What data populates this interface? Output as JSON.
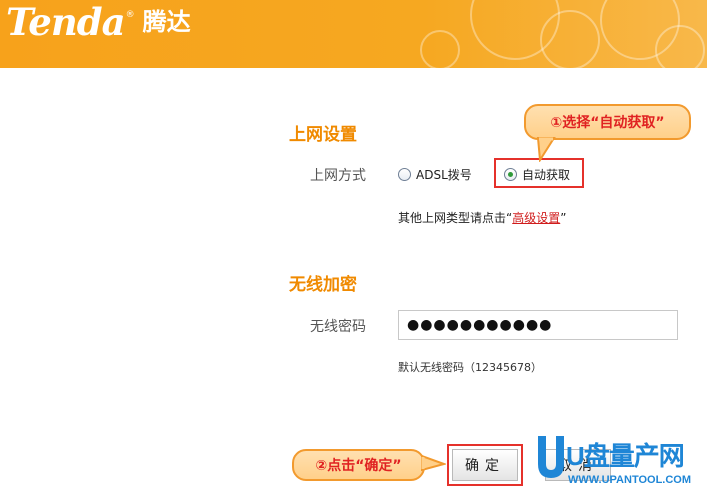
{
  "header": {
    "brand": "Tenda",
    "brand_cn": "腾达",
    "reg": "®"
  },
  "internet": {
    "title": "上网设置",
    "mode_label": "上网方式",
    "options": [
      "ADSL拨号",
      "自动获取"
    ],
    "selected": "自动获取",
    "hint_prefix": "其他上网类型请点击“",
    "hint_link": "高级设置",
    "hint_suffix": "”"
  },
  "wireless": {
    "title": "无线加密",
    "password_label": "无线密码",
    "password_value": "●●●●●●●●●●●",
    "default_hint": "默认无线密码（12345678）"
  },
  "buttons": {
    "ok": "确定",
    "cancel": "取消"
  },
  "callouts": {
    "step1": "①选择“自动获取”",
    "step2": "②点击“确定”"
  },
  "watermark": {
    "big": "U盘量产网",
    "url": "WWW.UPANTOOL.COM"
  },
  "colors": {
    "header": "#f7a21b",
    "accent": "#f08a00",
    "highlight": "#e5312b",
    "link": "#d01c1c"
  }
}
